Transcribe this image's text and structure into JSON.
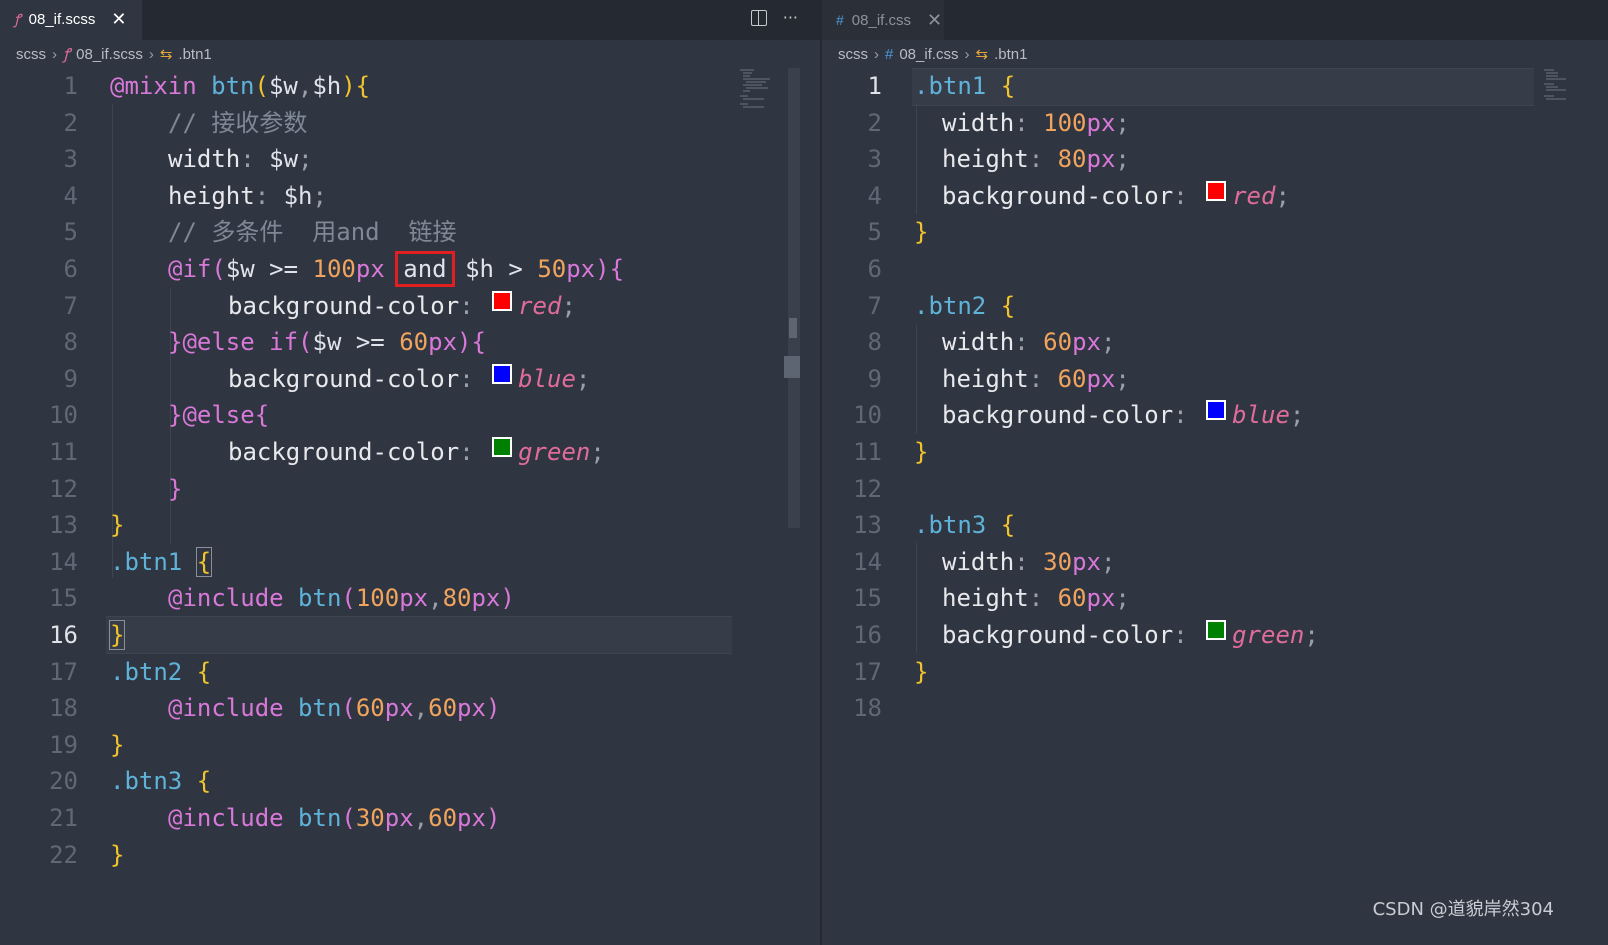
{
  "left": {
    "tab": {
      "icon": "sass-icon",
      "label": "08_if.scss",
      "close": "✕"
    },
    "breadcrumb": [
      "scss",
      "08_if.scss",
      ".btn1"
    ],
    "lines": [
      {
        "n": "1",
        "t": "@mixin btn($w,$h){"
      },
      {
        "n": "2",
        "t": "// 接收参数"
      },
      {
        "n": "3",
        "t": "width: $w;"
      },
      {
        "n": "4",
        "t": "height: $h;"
      },
      {
        "n": "5",
        "t": "// 多条件  用and  链接"
      },
      {
        "n": "6",
        "t": "@if($w >= 100px and $h > 50px){"
      },
      {
        "n": "7",
        "t": "background-color: red;"
      },
      {
        "n": "8",
        "t": "}@else if($w >= 60px){"
      },
      {
        "n": "9",
        "t": "background-color: blue;"
      },
      {
        "n": "10",
        "t": "}@else{"
      },
      {
        "n": "11",
        "t": "background-color: green;"
      },
      {
        "n": "12",
        "t": "}"
      },
      {
        "n": "13",
        "t": "}"
      },
      {
        "n": "14",
        "t": ".btn1 {"
      },
      {
        "n": "15",
        "t": "@include btn(100px,80px)"
      },
      {
        "n": "16",
        "t": "}"
      },
      {
        "n": "17",
        "t": ".btn2 {"
      },
      {
        "n": "18",
        "t": "@include btn(60px,60px)"
      },
      {
        "n": "19",
        "t": "}"
      },
      {
        "n": "20",
        "t": ".btn3 {"
      },
      {
        "n": "21",
        "t": "@include btn(30px,60px)"
      },
      {
        "n": "22",
        "t": "}"
      }
    ],
    "current_line": "16",
    "highlighted_word": "and"
  },
  "right": {
    "tab": {
      "icon": "css-icon",
      "label": "08_if.css",
      "close": "✕"
    },
    "breadcrumb": [
      "scss",
      "08_if.css",
      ".btn1"
    ],
    "lines": [
      {
        "n": "1",
        "t": ".btn1 {"
      },
      {
        "n": "2",
        "t": "width: 100px;"
      },
      {
        "n": "3",
        "t": "height: 80px;"
      },
      {
        "n": "4",
        "t": "background-color: red;"
      },
      {
        "n": "5",
        "t": "}"
      },
      {
        "n": "6",
        "t": ""
      },
      {
        "n": "7",
        "t": ".btn2 {"
      },
      {
        "n": "8",
        "t": "width: 60px;"
      },
      {
        "n": "9",
        "t": "height: 60px;"
      },
      {
        "n": "10",
        "t": "background-color: blue;"
      },
      {
        "n": "11",
        "t": "}"
      },
      {
        "n": "12",
        "t": ""
      },
      {
        "n": "13",
        "t": ".btn3 {"
      },
      {
        "n": "14",
        "t": "width: 30px;"
      },
      {
        "n": "15",
        "t": "height: 60px;"
      },
      {
        "n": "16",
        "t": "background-color: green;"
      },
      {
        "n": "17",
        "t": "}"
      },
      {
        "n": "18",
        "t": ""
      }
    ],
    "current_line": "1"
  },
  "colors": {
    "red": "#ff0000",
    "blue": "#0000ff",
    "green": "#008000",
    "highlight_box": "#e02020"
  },
  "watermark": "CSDN @道貌岸然304"
}
